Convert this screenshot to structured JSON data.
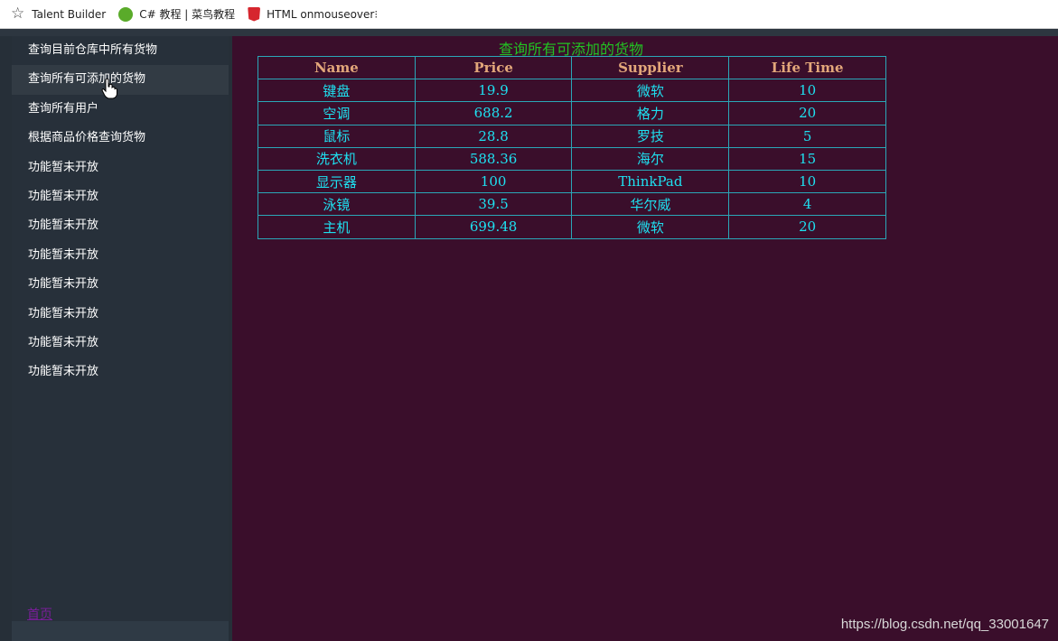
{
  "bookmarks": [
    {
      "label": "Talent Builder",
      "icon": "star-icon"
    },
    {
      "label": "C# 教程 | 菜鸟教程",
      "icon": "runoob-icon"
    },
    {
      "label": "HTML onmouseover",
      "icon": "html5-icon"
    }
  ],
  "bookmarks_more": "⁝",
  "sidebar": {
    "items": [
      {
        "label": "查询目前仓库中所有货物"
      },
      {
        "label": "查询所有可添加的货物"
      },
      {
        "label": "查询所有用户"
      },
      {
        "label": "根据商品价格查询货物"
      },
      {
        "label": "功能暂未开放"
      },
      {
        "label": "功能暂未开放"
      },
      {
        "label": "功能暂未开放"
      },
      {
        "label": "功能暂未开放"
      },
      {
        "label": "功能暂未开放"
      },
      {
        "label": "功能暂未开放"
      },
      {
        "label": "功能暂未开放"
      },
      {
        "label": "功能暂未开放"
      }
    ],
    "home_link": "首页"
  },
  "main": {
    "title": "查询所有可添加的货物",
    "table": {
      "headers": [
        "Name",
        "Price",
        "Supplier",
        "Life Time"
      ],
      "rows": [
        [
          "键盘",
          "19.9",
          "微软",
          "10"
        ],
        [
          "空调",
          "688.2",
          "格力",
          "20"
        ],
        [
          "鼠标",
          "28.8",
          "罗技",
          "5"
        ],
        [
          "洗衣机",
          "588.36",
          "海尔",
          "15"
        ],
        [
          "显示器",
          "100",
          "ThinkPad",
          "10"
        ],
        [
          "泳镜",
          "39.5",
          "华尔威",
          "4"
        ],
        [
          "主机",
          "699.48",
          "微软",
          "20"
        ]
      ]
    }
  },
  "watermark": "https://blog.csdn.net/qq_33001647",
  "colors": {
    "sidebar_bg": "#27303a",
    "main_bg": "#3a0e2b",
    "title": "#22c322",
    "header_text": "#e3a77a",
    "cell_text": "#1ee0f0",
    "border": "#2aa7b8",
    "home_link": "#7a1e9a"
  }
}
